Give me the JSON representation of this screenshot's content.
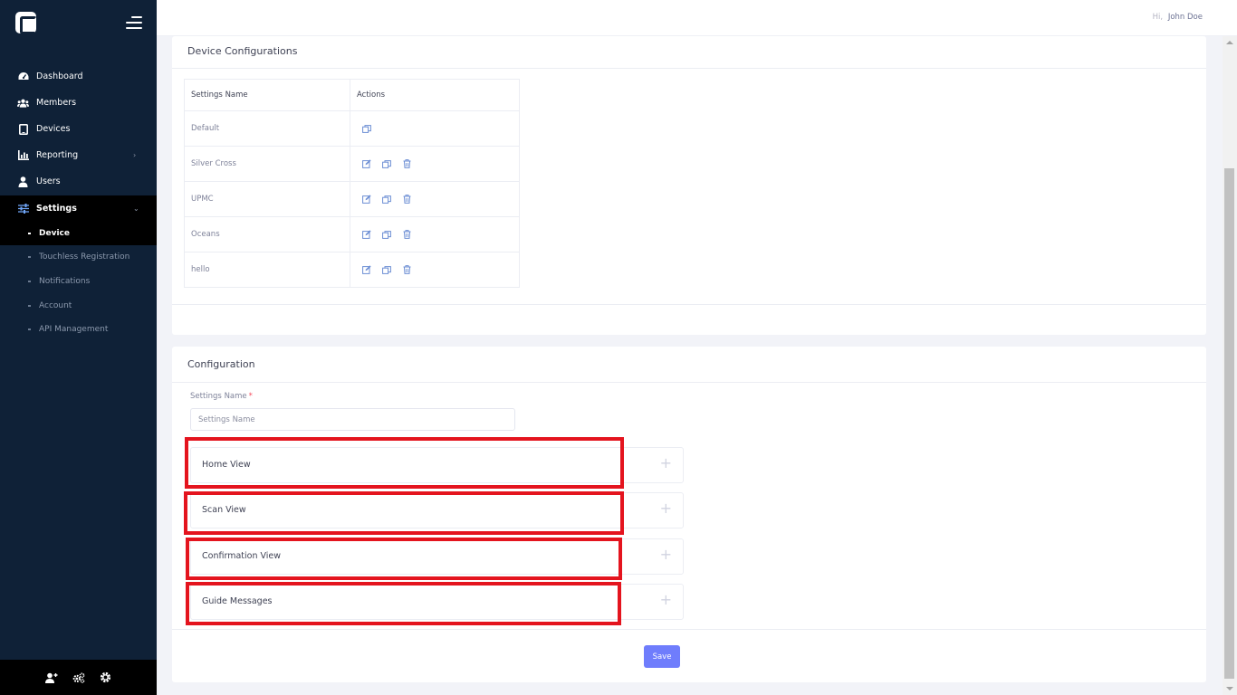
{
  "sidebar": {
    "menu": [
      {
        "label": "Dashboard",
        "icon": "speedometer-icon"
      },
      {
        "label": "Members",
        "icon": "users-icon"
      },
      {
        "label": "Devices",
        "icon": "tablet-icon"
      },
      {
        "label": "Reporting",
        "icon": "chart-icon",
        "arrow": "›"
      },
      {
        "label": "Users",
        "icon": "user-icon"
      },
      {
        "label": "Settings",
        "icon": "sliders-icon",
        "arrow": "⌄"
      }
    ],
    "submenu": [
      {
        "label": "Device"
      },
      {
        "label": "Touchless Registration"
      },
      {
        "label": "Notifications"
      },
      {
        "label": "Account"
      },
      {
        "label": "API Management"
      }
    ],
    "footer_icons": [
      "user-add-icon",
      "cogs-icon",
      "gear-icon"
    ]
  },
  "header": {
    "greeting": "Hi,",
    "user_name": "John Doe"
  },
  "device_configurations": {
    "title": "Device Configurations",
    "columns": [
      "Settings Name",
      "Actions"
    ],
    "rows": [
      {
        "name": "Default",
        "actions": [
          "copy"
        ]
      },
      {
        "name": "Silver Cross",
        "actions": [
          "edit",
          "copy",
          "delete"
        ]
      },
      {
        "name": "UPMC",
        "actions": [
          "edit",
          "copy",
          "delete"
        ]
      },
      {
        "name": "Oceans",
        "actions": [
          "edit",
          "copy",
          "delete"
        ]
      },
      {
        "name": "hello",
        "actions": [
          "edit",
          "copy",
          "delete"
        ]
      }
    ]
  },
  "configuration": {
    "title": "Configuration",
    "settings_name_label": "Settings Name",
    "required_mark": "*",
    "settings_name_placeholder": "Settings Name",
    "settings_name_value": "",
    "sections": [
      {
        "label": "Home View",
        "expand_icon": "+"
      },
      {
        "label": "Scan View",
        "expand_icon": "+"
      },
      {
        "label": "Confirmation View",
        "expand_icon": "+"
      },
      {
        "label": "Guide Messages",
        "expand_icon": "+"
      }
    ],
    "save_label": "Save"
  },
  "colors": {
    "sidebar_bg": "#0f2137",
    "active_bg": "#000000",
    "primary_button": "#6f7dfc",
    "highlight": "#e4141e",
    "action_icon": "#6c8ed4"
  }
}
